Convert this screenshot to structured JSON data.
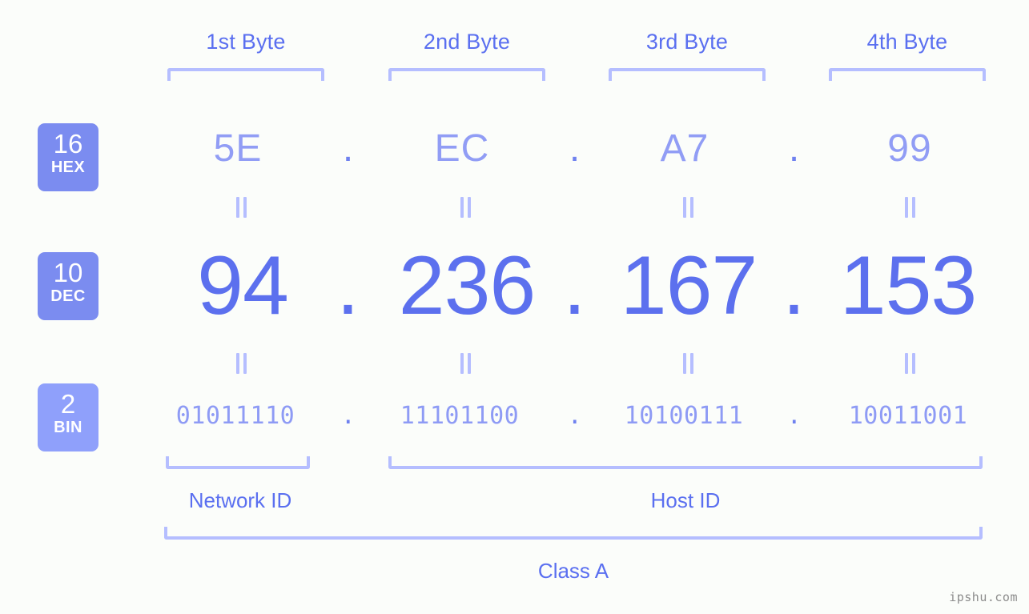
{
  "meta": {
    "ip_address": "94.236.167.153",
    "ip_class": "Class A",
    "watermark": "ipshu.com",
    "accent_color": "#5a6ff0",
    "bracket_color": "#b5beff",
    "badge_color": "#7b8cf0",
    "background_color": "#fbfdfa"
  },
  "byte_headers": [
    {
      "label": "1st Byte"
    },
    {
      "label": "2nd Byte"
    },
    {
      "label": "3rd Byte"
    },
    {
      "label": "4th Byte"
    }
  ],
  "rows": {
    "hex": {
      "base": "16",
      "unit": "HEX",
      "values": [
        "5E",
        "EC",
        "A7",
        "99"
      ],
      "separator": "."
    },
    "dec": {
      "base": "10",
      "unit": "DEC",
      "values": [
        "94",
        "236",
        "167",
        "153"
      ],
      "separator": "."
    },
    "bin": {
      "base": "2",
      "unit": "BIN",
      "values": [
        "01011110",
        "11101100",
        "10100111",
        "10011001"
      ],
      "separator": "."
    }
  },
  "equivalence_symbol": "=",
  "sections": {
    "network_id": "Network ID",
    "host_id": "Host ID",
    "class": "Class A"
  }
}
